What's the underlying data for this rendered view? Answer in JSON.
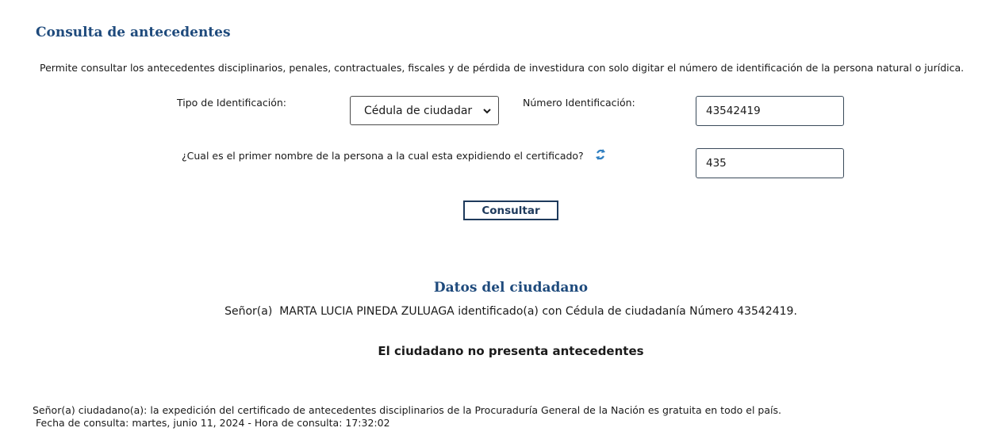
{
  "header": {
    "title": "Consulta de antecedentes",
    "description": "Permite consultar los antecedentes disciplinarios, penales, contractuales, fiscales y de pérdida de investidura con solo digitar el número de identificación de la persona natural o jurídica."
  },
  "form": {
    "tipo_label": "Tipo de Identificación:",
    "tipo_value": "Cédula de ciudadar",
    "numero_label": "Número Identificación:",
    "numero_value": "43542419",
    "pregunta_label": "¿Cual es el primer nombre de la persona a la cual esta expidiendo el certificado?",
    "respuesta_value": "435",
    "submit_label": "Consultar"
  },
  "result": {
    "section_title": "Datos del ciudadano",
    "citizen_line": "Señor(a)  MARTA LUCIA PINEDA ZULUAGA identificado(a) con Cédula de ciudadanía Número 43542419.",
    "status": "El ciudadano no presenta antecedentes"
  },
  "footer": {
    "note": "Señor(a) ciudadano(a): la expedición del certificado de antecedentes disciplinarios de la Procuraduría General de la Nación es gratuita en todo el país.",
    "date_line": "Fecha de consulta: martes, junio 11, 2024 - Hora de consulta: 17:32:02"
  },
  "colors": {
    "title_blue": "#1e4a7c",
    "button_border": "#1e3a5c",
    "refresh_icon": "#2f7fc1"
  },
  "icons": {
    "refresh": "refresh-icon",
    "select_chevron": "chevron-down-icon"
  }
}
